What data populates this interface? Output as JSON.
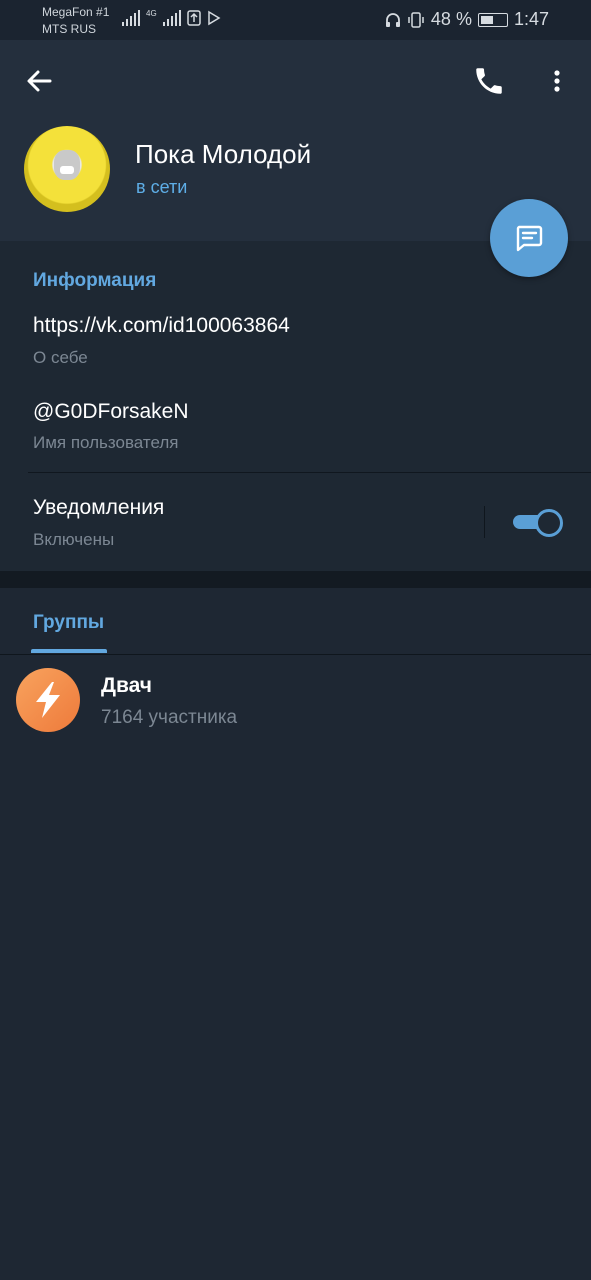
{
  "status_bar": {
    "carrier_1": "MegaFon #1",
    "carrier_2": "MTS RUS",
    "network": "4G",
    "battery": "48 %",
    "time": "1:47"
  },
  "header": {
    "name": "Пока Молодой",
    "status": "в сети"
  },
  "info": {
    "section_title": "Информация",
    "bio_value": "https://vk.com/id100063864",
    "bio_label": "О себе",
    "username_value": "@G0DForsakeN",
    "username_label": "Имя пользователя",
    "notifications_label": "Уведомления",
    "notifications_state": "Включены",
    "notifications_enabled": true
  },
  "groups": {
    "tab_label": "Группы",
    "items": [
      {
        "name": "Двач",
        "members": "7164 участника"
      }
    ]
  },
  "colors": {
    "accent": "#62a8e0",
    "fab": "#5a9fd6",
    "header_bg": "#242f3d",
    "body_bg": "#1e2733",
    "group_avatar": "#f28c48"
  },
  "icons": [
    "back-arrow-icon",
    "phone-icon",
    "more-vert-icon",
    "message-icon",
    "lightning-icon",
    "toggle-switch"
  ]
}
